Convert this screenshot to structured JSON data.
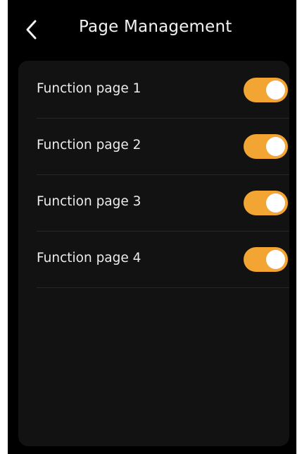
{
  "header": {
    "title": "Page Management",
    "back_icon": "chevron-left-icon"
  },
  "colors": {
    "background": "#000000",
    "card": "#121212",
    "toggle_on": "#f3a534",
    "knob": "#ffffff",
    "text": "#ececec"
  },
  "pages": [
    {
      "label": "Function page 1",
      "enabled": true
    },
    {
      "label": "Function page 2",
      "enabled": true
    },
    {
      "label": "Function page 3",
      "enabled": true
    },
    {
      "label": "Function page 4",
      "enabled": true
    }
  ]
}
